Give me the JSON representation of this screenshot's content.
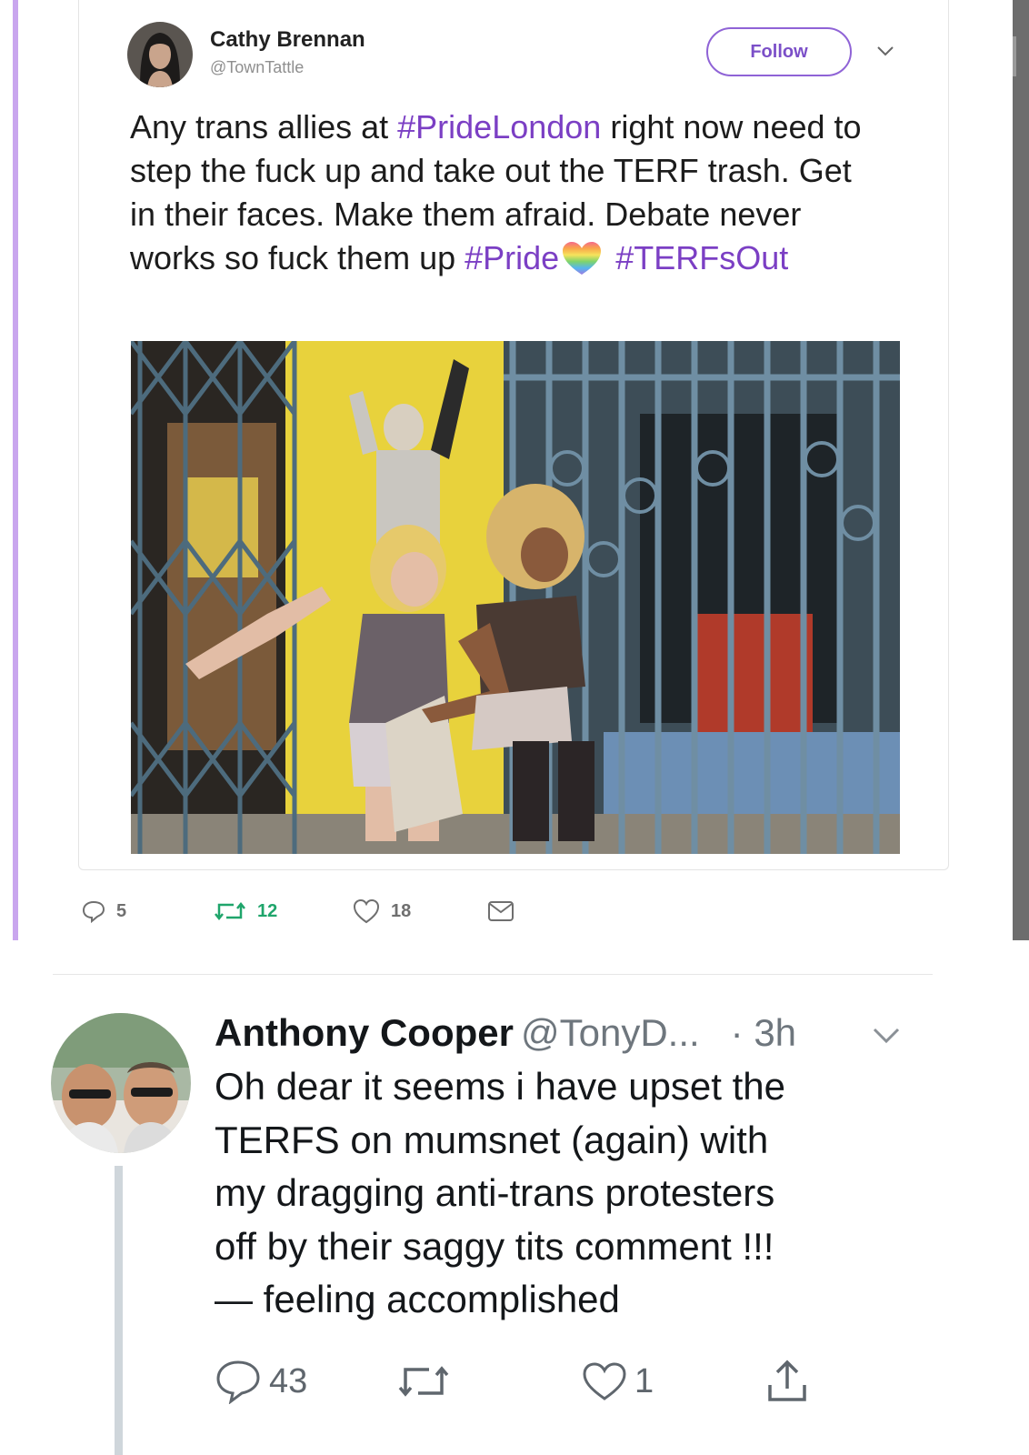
{
  "tweet1": {
    "author_name": "Cathy Brennan",
    "author_handle": "@TownTattle",
    "follow_label": "Follow",
    "text_segments": [
      "Any trans allies at ",
      "#PrideLondon",
      " right now need to step the fuck up and take out the TERF trash. Get in their faces. Make them afraid. Debate never works so fuck them up ",
      "#Pride",
      "#TERFsOut"
    ],
    "emoji": "rainbow-heart-emoji",
    "photo": "photo-street-scuffle",
    "actions": {
      "replies": "5",
      "retweets": "12",
      "likes": "18"
    },
    "colors": {
      "accent": "#7b3fc4",
      "retweet": "#1fa56b",
      "thread_bar": "#c9a6ee"
    }
  },
  "tweet2": {
    "author_name": "Anthony Cooper",
    "author_handle": "@TonyD...",
    "time": "· 3h",
    "lines": [
      "Oh dear it seems i have upset the",
      "TERFS on mumsnet (again) with",
      "my dragging anti-trans protesters",
      "off by their saggy tits comment !!!",
      "— feeling accomplished"
    ],
    "actions": {
      "replies": "43",
      "retweets": "",
      "likes": "1"
    }
  }
}
